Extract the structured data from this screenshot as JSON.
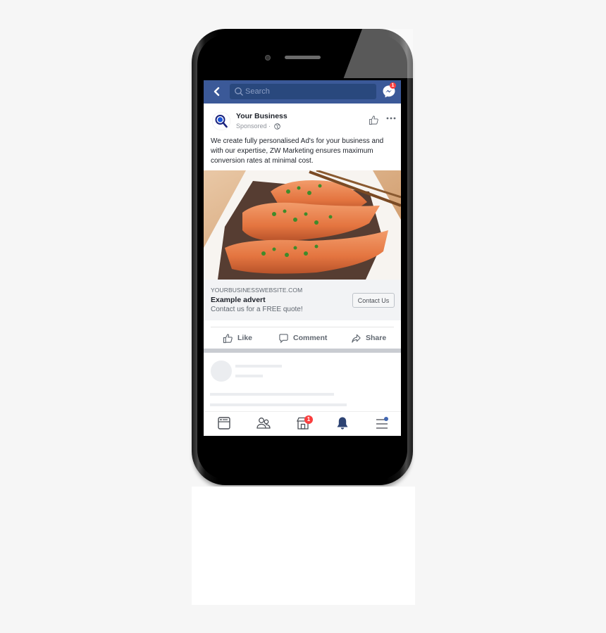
{
  "topbar": {
    "search_placeholder": "Search",
    "messenger_badge": "1",
    "icons": [
      "back-icon",
      "search-icon",
      "messenger-icon"
    ]
  },
  "post": {
    "page_name": "Your Business",
    "sponsored_label": "Sponsored ·",
    "body": "We create fully personalised Ad's for your business and with our expertise, ZW Marketing ensures maximum conversion rates at minimal cost.",
    "image_description": "Glazed salmon fillets with green onions and sesame on a white plate with chopsticks",
    "link": {
      "url": "YOURBUSINESSWEBSITE.COM",
      "title": "Example advert",
      "description": "Contact us for a FREE quote!",
      "cta_label": "Contact Us"
    },
    "actions": [
      {
        "label": "Like",
        "icon": "like-icon"
      },
      {
        "label": "Comment",
        "icon": "comment-icon"
      },
      {
        "label": "Share",
        "icon": "share-icon"
      }
    ]
  },
  "bottom_nav": {
    "items": [
      {
        "name": "news-feed",
        "icon": "news-feed-icon"
      },
      {
        "name": "friends",
        "icon": "friends-icon"
      },
      {
        "name": "marketplace",
        "icon": "marketplace-icon",
        "badge": "1"
      },
      {
        "name": "notifications",
        "icon": "bell-icon",
        "active": true
      },
      {
        "name": "menu",
        "icon": "menu-icon"
      }
    ]
  },
  "colors": {
    "brand": "#3b5998",
    "badge": "#fa3e3e",
    "active_icon": "#2d4373"
  }
}
